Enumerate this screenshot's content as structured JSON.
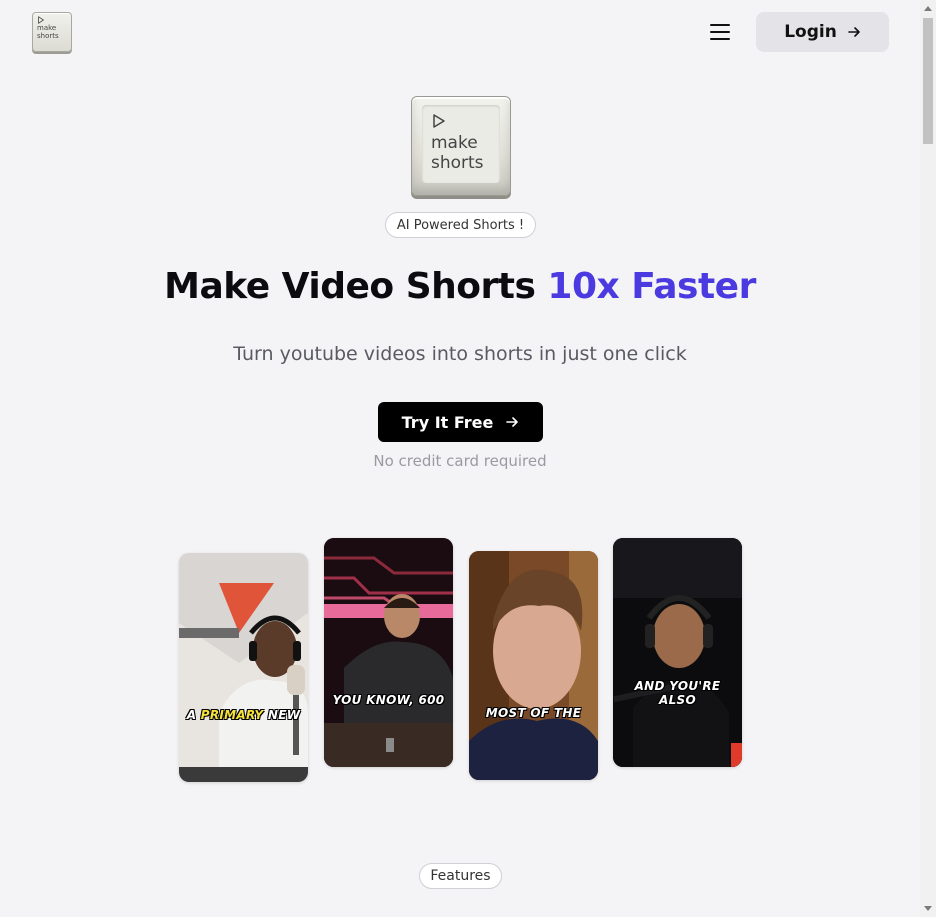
{
  "header": {
    "logo_text": "make shorts",
    "menu_icon": "hamburger-menu-icon",
    "login_label": "Login",
    "login_icon": "arrow-right-icon"
  },
  "hero": {
    "logo_text_line1": "make",
    "logo_text_line2": "shorts",
    "badge": "AI Powered Shorts !",
    "headline_main": "Make Video Shorts ",
    "headline_accent": "10x Faster",
    "subheadline": "Turn youtube videos into shorts in just one click",
    "cta_label": "Try It Free",
    "cta_icon": "arrow-right-icon",
    "note": "No credit card required"
  },
  "colors": {
    "accent": "#4a3ae0",
    "background": "#f4f4f6",
    "cta_bg": "#000000",
    "caption_highlight": "#f5e23a"
  },
  "cards": [
    {
      "caption_a": "A ",
      "caption_highlight": "PRIMARY",
      "caption_b": " NEW"
    },
    {
      "caption": "YOU KNOW, 600"
    },
    {
      "caption": "MOST OF THE"
    },
    {
      "caption_line1": "AND YOU'RE",
      "caption_line2": "ALSO"
    }
  ],
  "features_label": "Features"
}
